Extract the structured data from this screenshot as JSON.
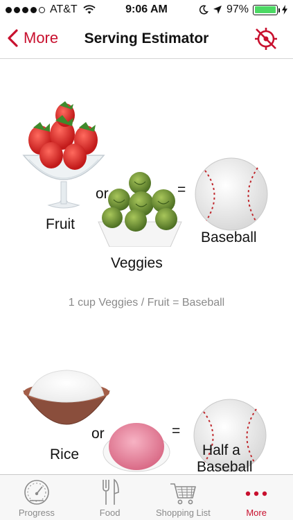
{
  "status_bar": {
    "carrier": "AT&T",
    "time": "9:06 AM",
    "battery": "97%",
    "battery_level": 0.97
  },
  "nav": {
    "back_label": "More",
    "title": "Serving Estimator"
  },
  "sections": [
    {
      "labels": {
        "food1": "Fruit",
        "or": "or",
        "food2": "Veggies",
        "equals": "=",
        "result": "Baseball"
      },
      "caption": "1 cup Veggies / Fruit = Baseball"
    },
    {
      "labels": {
        "food1": "Rice",
        "or": "or",
        "equals": "=",
        "result_line1": "Half a",
        "result_line2": "Baseball"
      }
    }
  ],
  "tabs": [
    {
      "label": "Progress",
      "icon": "gauge-icon"
    },
    {
      "label": "Food",
      "icon": "fork-knife-icon"
    },
    {
      "label": "Shopping List",
      "icon": "cart-icon"
    },
    {
      "label": "More",
      "icon": "more-dots-icon",
      "active": true
    }
  ],
  "colors": {
    "accent": "#c8102e",
    "caption_gray": "#8a8a8a",
    "battery_green": "#4cd964"
  }
}
